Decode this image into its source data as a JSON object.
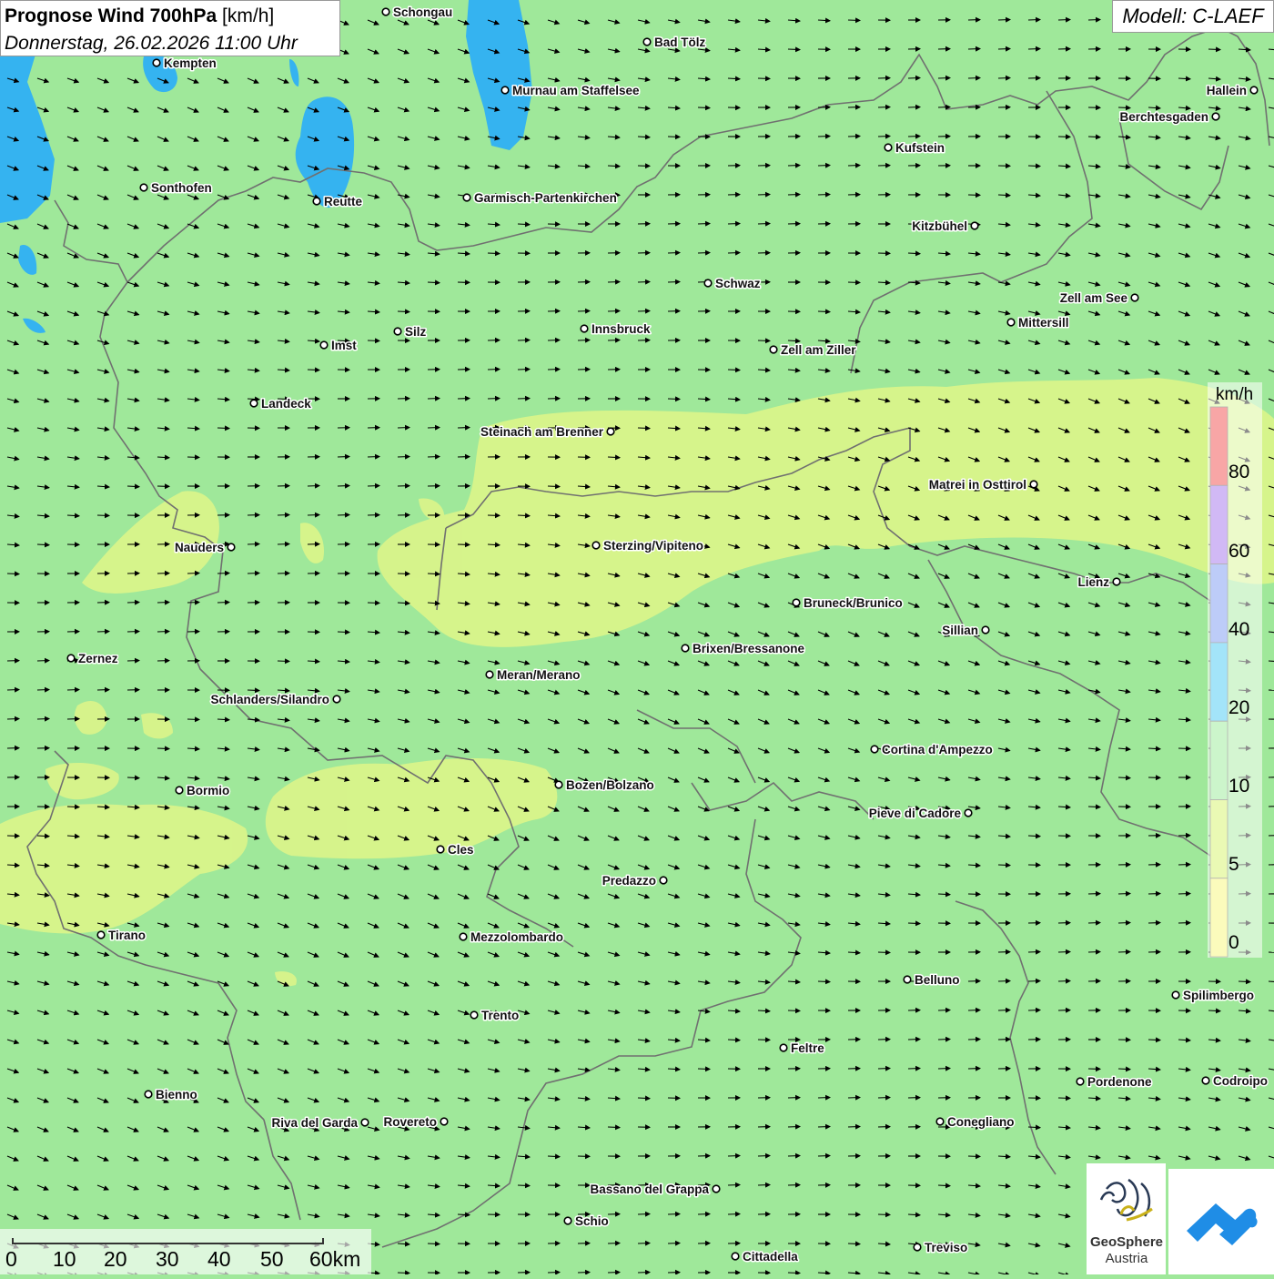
{
  "title": {
    "main": "Prognose Wind 700hPa",
    "unit": " [km/h]",
    "date": "Donnerstag, 26.02.2026 11:00 Uhr"
  },
  "model_label": "Modell: C-LAEF",
  "colors": {
    "land_green": "#9fe89a",
    "yellow_band": "#dcf58a",
    "lake": "#35b3f0",
    "border": "#707070",
    "arrow": "#000000"
  },
  "legend": {
    "unit": "km/h",
    "ticks": [
      "80",
      "60",
      "40",
      "20",
      "10",
      "5",
      "0"
    ],
    "bands": [
      {
        "range": "> 80",
        "color": "#f03a3a"
      },
      {
        "range": "60-80",
        "color": "#9a65e8"
      },
      {
        "range": "40-60",
        "color": "#6e8ef0"
      },
      {
        "range": "20-40",
        "color": "#33c4f2"
      },
      {
        "range": "10-20",
        "color": "#8fe88c"
      },
      {
        "range": "5-10",
        "color": "#d0f15a"
      },
      {
        "range": "0-5",
        "color": "#f5f56a"
      }
    ]
  },
  "cities": [
    {
      "name": "Schongau",
      "label_side": "right"
    },
    {
      "name": "Bad Tölz",
      "label_side": "right"
    },
    {
      "name": "Kempten",
      "label_side": "right"
    },
    {
      "name": "Murnau am Staffelsee",
      "label_side": "right"
    },
    {
      "name": "Hallein",
      "label_side": "left"
    },
    {
      "name": "Berchtesgaden",
      "label_side": "left"
    },
    {
      "name": "Kufstein",
      "label_side": "right"
    },
    {
      "name": "Sonthofen",
      "label_side": "right"
    },
    {
      "name": "Reutte",
      "label_side": "right"
    },
    {
      "name": "Garmisch-Partenkirchen",
      "label_side": "right"
    },
    {
      "name": "Kitzbühel",
      "label_side": "left"
    },
    {
      "name": "Schwaz",
      "label_side": "right"
    },
    {
      "name": "Zell am See",
      "label_side": "left"
    },
    {
      "name": "Mittersill",
      "label_side": "right"
    },
    {
      "name": "Innsbruck",
      "label_side": "right"
    },
    {
      "name": "Silz",
      "label_side": "right"
    },
    {
      "name": "Imst",
      "label_side": "right"
    },
    {
      "name": "Zell am Ziller",
      "label_side": "right"
    },
    {
      "name": "Landeck",
      "label_side": "right"
    },
    {
      "name": "Steinach am Brenner",
      "label_side": "left"
    },
    {
      "name": "Matrei in Osttirol",
      "label_side": "left"
    },
    {
      "name": "Nauders",
      "label_side": "left"
    },
    {
      "name": "Sterzing/Vipiteno",
      "label_side": "right"
    },
    {
      "name": "Lienz",
      "label_side": "left"
    },
    {
      "name": "Bruneck/Brunico",
      "label_side": "right"
    },
    {
      "name": "Sillian",
      "label_side": "left"
    },
    {
      "name": "Zernez",
      "label_side": "right"
    },
    {
      "name": "Brixen/Bressanone",
      "label_side": "right"
    },
    {
      "name": "Meran/Merano",
      "label_side": "right"
    },
    {
      "name": "Schlanders/Silandro",
      "label_side": "left"
    },
    {
      "name": "Cortina d'Ampezzo",
      "label_side": "right"
    },
    {
      "name": "Bormio",
      "label_side": "right"
    },
    {
      "name": "Bozen/Bolzano",
      "label_side": "right"
    },
    {
      "name": "Pieve di Cadore",
      "label_side": "left"
    },
    {
      "name": "Cles",
      "label_side": "right"
    },
    {
      "name": "Predazzo",
      "label_side": "left"
    },
    {
      "name": "Tirano",
      "label_side": "right"
    },
    {
      "name": "Mezzolombardo",
      "label_side": "right"
    },
    {
      "name": "Belluno",
      "label_side": "right"
    },
    {
      "name": "Spilimbergo",
      "label_side": "right"
    },
    {
      "name": "Trento",
      "label_side": "right"
    },
    {
      "name": "Feltre",
      "label_side": "right"
    },
    {
      "name": "Pordenone",
      "label_side": "right"
    },
    {
      "name": "Codroipo",
      "label_side": "right"
    },
    {
      "name": "Bienno",
      "label_side": "right"
    },
    {
      "name": "Riva del Garda",
      "label_side": "left"
    },
    {
      "name": "Rovereto",
      "label_side": "left"
    },
    {
      "name": "Conegliano",
      "label_side": "right"
    },
    {
      "name": "Bassano del Grappa",
      "label_side": "left"
    },
    {
      "name": "Schio",
      "label_side": "right"
    },
    {
      "name": "Treviso",
      "label_side": "right"
    },
    {
      "name": "Cittadella",
      "label_side": "right"
    }
  ],
  "scale_bar": {
    "labels": [
      "0",
      "10",
      "20",
      "30",
      "40",
      "50",
      "60km"
    ]
  },
  "logos": {
    "geosphere_line1": "GeoSphere",
    "geosphere_line2": "Austria"
  }
}
